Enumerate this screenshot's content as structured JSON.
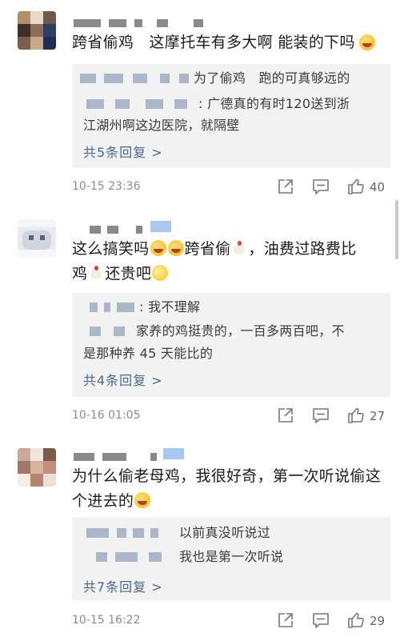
{
  "comments": [
    {
      "text": "跨省偷鸡　这摩托车有多大啊 能装的下吗",
      "replies": [
        "为了偷鸡　跑的可真够远的",
        ": 广德真的有时120送到浙",
        "江湖州啊这边医院，就隔壁"
      ],
      "more": "共5条回复 >",
      "date": "10-15 23:36",
      "likes": "40"
    },
    {
      "text_parts": [
        "这么搞笑吗",
        "跨省偷",
        "，油费过路费比",
        "鸡",
        "还贵吧"
      ],
      "replies": [
        ": 我不理解",
        "家养的鸡挺贵的，一百多两百吧，不",
        "是那种养 45 天能比的"
      ],
      "more": "共4条回复 >",
      "date": "10-16 01:05",
      "likes": "27"
    },
    {
      "text": "为什么偷老母鸡，我很好奇，第一次听说偷这个进去的",
      "replies": [
        "以前真没听说过",
        "我也是第一次听说"
      ],
      "more": "共7条回复 >",
      "date": "10-15 16:22",
      "likes": "29"
    }
  ],
  "icons": [
    "share-icon",
    "comment-icon",
    "like-icon"
  ],
  "colors": {
    "link": "#4a6791",
    "reply_bg": "#f2f2f2",
    "meta_text": "#8c8c8c"
  }
}
